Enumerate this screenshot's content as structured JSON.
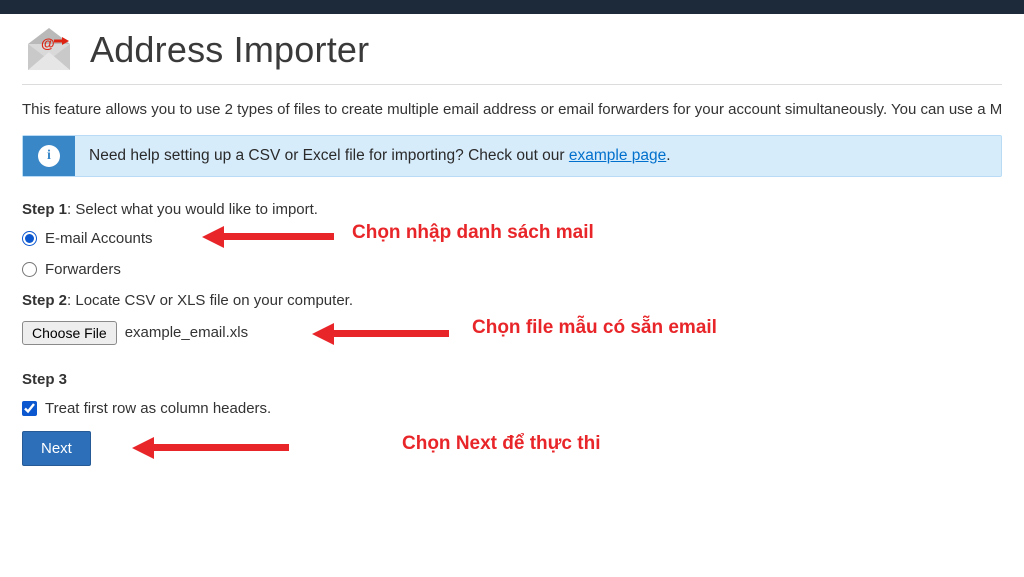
{
  "header": {
    "title": "Address Importer"
  },
  "intro": "This feature allows you to use 2 types of files to create multiple email address or email forwarders for your account simultaneously. You can use a Microsoft Excel spreadsheet (.xls) or a comma-separated values file (.csv) to import the data. A CSV file is a plain text file that has been given a .csv extension.",
  "help": {
    "text_before": "Need help setting up a CSV or Excel file for importing? Check out our ",
    "link_text": "example page",
    "text_after": "."
  },
  "step1": {
    "label": "Step 1",
    "text": ": Select what you would like to import.",
    "options": {
      "email_accounts": "E-mail Accounts",
      "forwarders": "Forwarders"
    }
  },
  "step2": {
    "label": "Step 2",
    "text": ": Locate CSV or XLS file on your computer.",
    "choose_btn": "Choose File",
    "file_name": "example_email.xls"
  },
  "step3": {
    "label": "Step 3",
    "checkbox_label": "Treat first row as column headers."
  },
  "buttons": {
    "next": "Next"
  },
  "annotations": {
    "a1": "Chọn nhập danh sách mail",
    "a2": "Chọn file mẫu có sẵn  email",
    "a3": "Chọn  Next để thực thi"
  }
}
